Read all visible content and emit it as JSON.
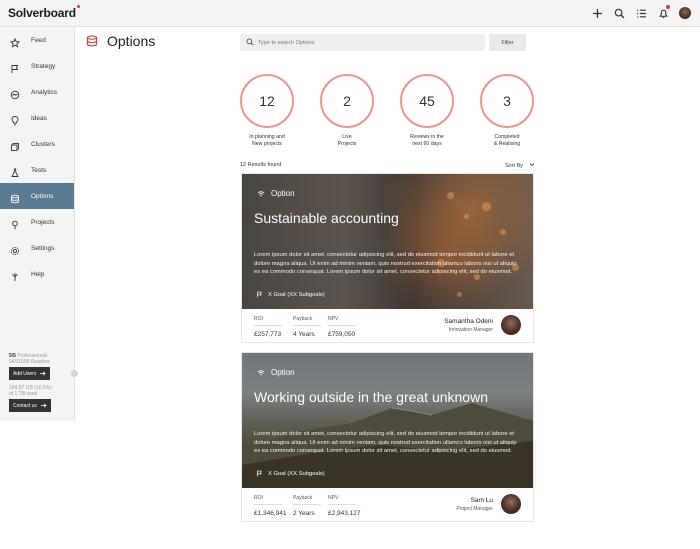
{
  "app": {
    "name": "Solverboard"
  },
  "topbar": {
    "icons": [
      "plus-icon",
      "search-icon",
      "list-icon",
      "bell-icon",
      "avatar"
    ],
    "accent": "#e2382f"
  },
  "sidebar": {
    "items": [
      {
        "label": "Feed",
        "icon": "star-icon"
      },
      {
        "label": "Strategy",
        "icon": "flag-icon"
      },
      {
        "label": "Analytics",
        "icon": "chart-icon"
      },
      {
        "label": "Ideas",
        "icon": "bulb-icon"
      },
      {
        "label": "Clusters",
        "icon": "clusters-icon"
      },
      {
        "label": "Tests",
        "icon": "flask-icon"
      },
      {
        "label": "Options",
        "icon": "layers-icon",
        "active": true
      },
      {
        "label": "Projects",
        "icon": "pin-icon"
      },
      {
        "label": "Settings",
        "icon": "gear-icon"
      },
      {
        "label": "Help",
        "icon": "help-icon"
      }
    ],
    "plan_count": "5/5",
    "plan_name": "Professionals",
    "plan_extra": "94/11098 Readers",
    "add_users": "Add Users",
    "storage_line1": "104.97 GB (10.5%)",
    "storage_line2": "of 1 TB used",
    "contact_us": "Contact us"
  },
  "header": {
    "title": "Options",
    "search_placeholder": "Type to search Options",
    "filter_label": "Filter"
  },
  "stats": [
    {
      "value": "12",
      "label_line1": "In planning and",
      "label_line2": "New projects"
    },
    {
      "value": "2",
      "label_line1": "Live",
      "label_line2": "Projects"
    },
    {
      "value": "45",
      "label_line1": "Reviews in the",
      "label_line2": "next 60 days"
    },
    {
      "value": "3",
      "label_line1": "Completed",
      "label_line2": "& Realising"
    }
  ],
  "results": {
    "count_text": "12 Results found",
    "sort_label": "Sort By"
  },
  "cards": [
    {
      "tag": "Option",
      "title": "Sustainable accounting",
      "body": "Lorem ipsum dolor sit amet, consectetur adipiscing elit, sed do eiusmod tempor incididunt ut labore et dolore magna aliqua. Ut enim ad minim veniam, quis nostrud exercitation ullamco laboris nisi ut aliquip ex ea commodo consequat. Lorem ipsum dolor sit amet, consectetur adipiscing elit, sed do eiusmod.",
      "goal": "X Goal (XX Subgoals)",
      "metrics": [
        {
          "label": "ROI",
          "value": "£257,773"
        },
        {
          "label": "Payback",
          "value": "4 Years"
        },
        {
          "label": "NPV",
          "value": "£759,050"
        }
      ],
      "person_name": "Samantha Odeni",
      "person_role": "Innovation Manager"
    },
    {
      "tag": "Option",
      "title": "Working outside in the great unknown",
      "body": "Lorem ipsum dolor sit amet, consectetur adipiscing elit, sed do eiusmod tempor incididunt ut labore et dolore magna aliqua. Ut enim ad minim veniam, quis nostrud exercitation ullamco laboris nisi ut aliquip ex ea commodo consequat. Lorem ipsum dolor sit amet, consectetur adipiscing elit, sed do eiusmod.",
      "goal": "X Goal (XX Subgoals)",
      "metrics": [
        {
          "label": "ROI",
          "value": "£1,346,941"
        },
        {
          "label": "Payback",
          "value": "2 Years"
        },
        {
          "label": "NPV",
          "value": "£2,943,127"
        }
      ],
      "person_name": "Sam Lu",
      "person_role": "Project Manager"
    }
  ],
  "colors": {
    "active_nav": "#5a7a91",
    "ring": "#f2938a",
    "title_icon": "#e2382f"
  }
}
